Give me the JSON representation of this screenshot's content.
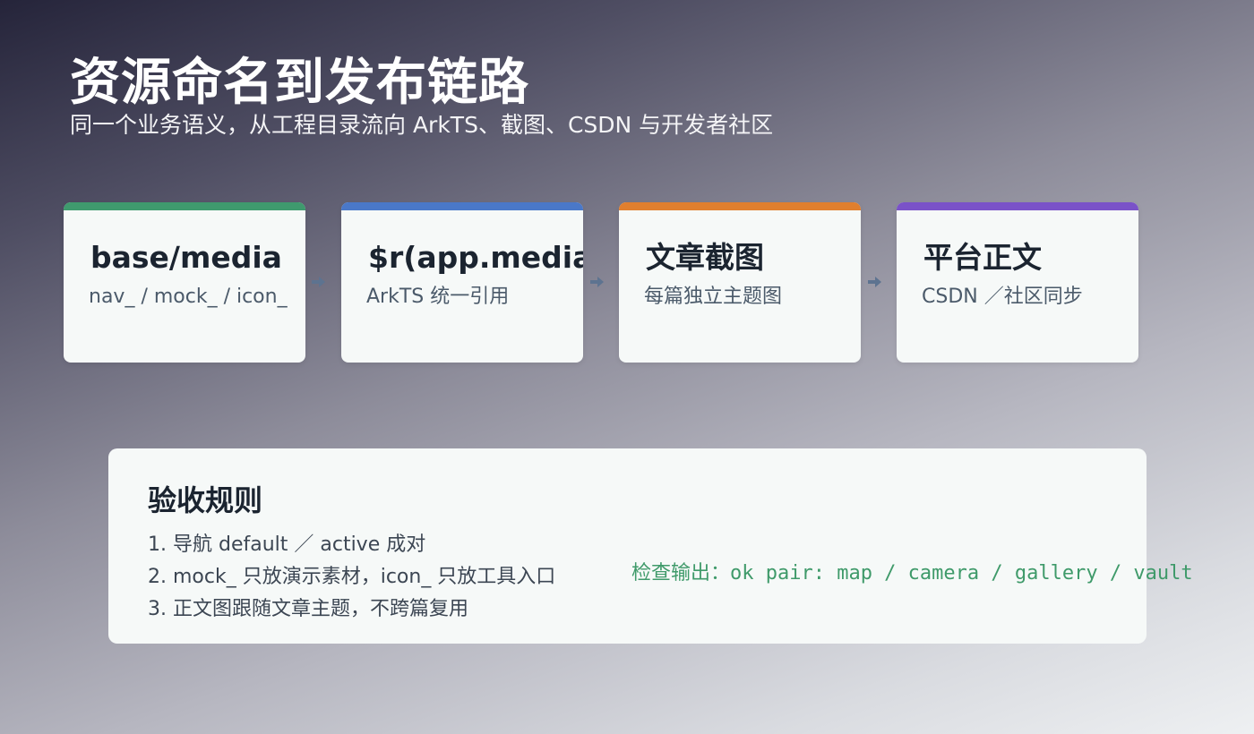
{
  "header": {
    "title": "资源命名到发布链路",
    "subtitle": "同一个业务语义，从工程目录流向 ArkTS、截图、CSDN 与开发者社区"
  },
  "pipeline": [
    {
      "title": "base/media",
      "subtitle": "nav_ / mock_ / icon_",
      "accent": "#3f9a6e"
    },
    {
      "title": "$r(app.media)",
      "subtitle": "ArkTS 统一引用",
      "accent": "#4a78c8"
    },
    {
      "title": "文章截图",
      "subtitle": "每篇独立主题图",
      "accent": "#e07f2e"
    },
    {
      "title": "平台正文",
      "subtitle": "CSDN ／社区同步",
      "accent": "#7a52c8"
    }
  ],
  "rules": {
    "title": "验收规则",
    "items": [
      "1. 导航 default ／ active 成对",
      "2. mock_ 只放演示素材，icon_ 只放工具入口",
      "3. 正文图跟随文章主题，不跨篇复用"
    ],
    "check_output": "检查输出：ok pair: map / camera / gallery / vault"
  },
  "colors": {
    "arrow": "#5d7390",
    "check_text": "#3f9a6a"
  },
  "icons": {
    "arrow": "arrow-right-icon"
  }
}
